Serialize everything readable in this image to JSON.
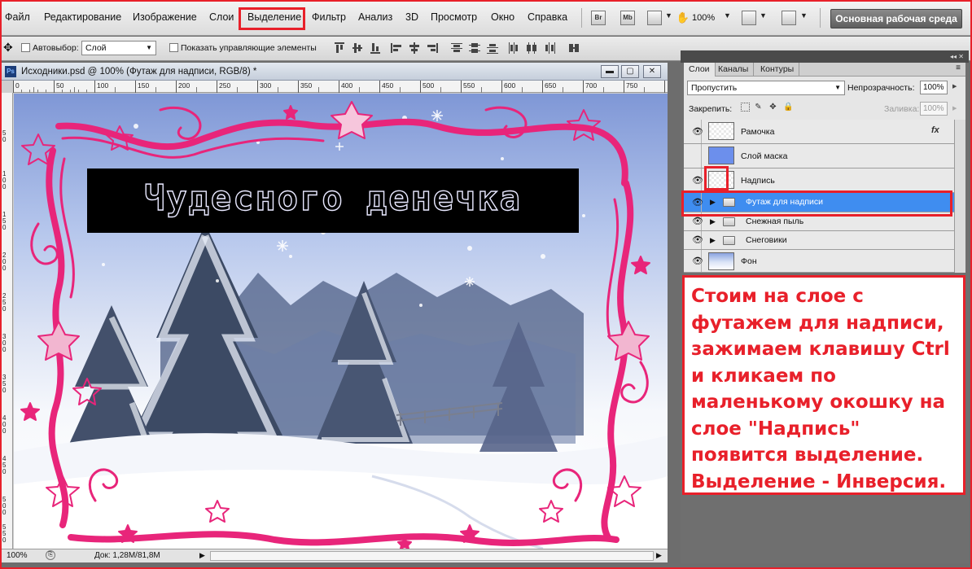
{
  "menubar": {
    "items": [
      "Файл",
      "Редактирование",
      "Изображение",
      "Слои",
      "Выделение",
      "Фильтр",
      "Анализ",
      "3D",
      "Просмотр",
      "Окно",
      "Справка"
    ],
    "highlighted_item": "Выделение",
    "bridge_badge": "Br",
    "minibridge_badge": "Mb",
    "zoom": "100%",
    "workspace_button": "Основная рабочая среда"
  },
  "options_bar": {
    "auto_select_label": "Автовыбор:",
    "auto_select_value": "Слой",
    "show_controls_label": "Показать управляющие элементы"
  },
  "document": {
    "title": "Исходники.psd @ 100% (Футаж для надписи, RGB/8) *",
    "caption_text": "Чудесного денечка",
    "ruler_h": [
      "0",
      "50",
      "100",
      "150",
      "200",
      "250",
      "300",
      "350",
      "400",
      "450",
      "500",
      "550",
      "600",
      "650",
      "700",
      "750"
    ],
    "ruler_v": [
      "5 0",
      "1 0 0",
      "1 5 0",
      "2 0 0",
      "2 5 0",
      "3 0 0",
      "3 5 0",
      "4 0 0",
      "4 5 0",
      "5 0 0",
      "5 5 0"
    ],
    "zoom": "100%",
    "doc_size": "Док: 1,28M/81,8M"
  },
  "layers_panel": {
    "tabs": [
      "Слои",
      "Каналы",
      "Контуры"
    ],
    "active_tab": "Слои",
    "blend_mode": "Пропустить",
    "opacity_label": "Непрозрачность:",
    "opacity_value": "100%",
    "lock_label": "Закрепить:",
    "fill_label": "Заливка:",
    "fill_value": "100%",
    "layers": [
      {
        "name": "Рамочка",
        "visible": true,
        "type": "image",
        "fx": "fx"
      },
      {
        "name": "Слой маска",
        "visible": false,
        "type": "solid"
      },
      {
        "name": "Надпись",
        "visible": true,
        "type": "image"
      },
      {
        "name": "Футаж для надписи",
        "visible": true,
        "type": "group",
        "selected": true
      },
      {
        "name": "Снежная пыль",
        "visible": true,
        "type": "group"
      },
      {
        "name": "Снеговики",
        "visible": true,
        "type": "group"
      },
      {
        "name": "Фон",
        "visible": true,
        "type": "photo"
      }
    ]
  },
  "annotation": {
    "text": "Стоим на слое с футажем для надписи, зажимаем клавишу Ctrl и кликаем по маленькому окошку на слое \"Надпись\" появится выделение. Выделение - Инверсия."
  },
  "colors": {
    "highlight_red": "#e8202a",
    "selection_blue": "#3f8df0",
    "frame_pink": "#e8257a"
  }
}
